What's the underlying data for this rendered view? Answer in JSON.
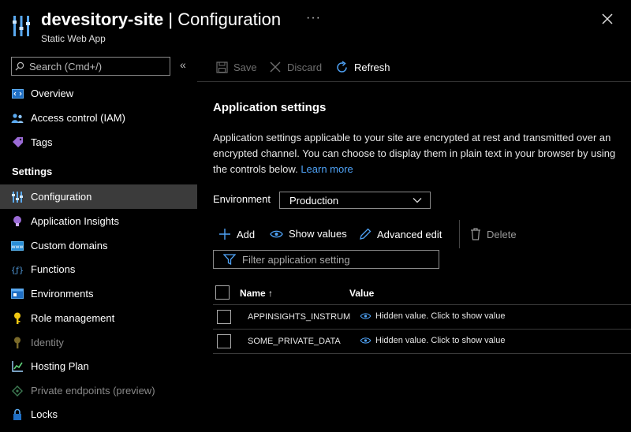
{
  "header": {
    "resource_name": "devesitory-site",
    "separator": " | ",
    "blade_title": "Configuration",
    "subtitle": "Static Web App",
    "more_label": "···"
  },
  "sidebar": {
    "search_placeholder": "Search (Cmd+/)",
    "collapse_label": "«",
    "top_items": [
      {
        "label": "Overview",
        "icon": "overview-icon"
      },
      {
        "label": "Access control (IAM)",
        "icon": "people-icon"
      },
      {
        "label": "Tags",
        "icon": "tag-icon"
      }
    ],
    "section_label": "Settings",
    "settings_items": [
      {
        "label": "Configuration",
        "icon": "sliders-icon",
        "active": true
      },
      {
        "label": "Application Insights",
        "icon": "lightbulb-icon"
      },
      {
        "label": "Custom domains",
        "icon": "globe-box-icon"
      },
      {
        "label": "Functions",
        "icon": "function-icon"
      },
      {
        "label": "Environments",
        "icon": "environment-icon"
      },
      {
        "label": "Role management",
        "icon": "key-icon"
      },
      {
        "label": "Identity",
        "icon": "identity-key-icon",
        "disabled": true
      },
      {
        "label": "Hosting Plan",
        "icon": "chart-icon"
      },
      {
        "label": "Private endpoints (preview)",
        "icon": "endpoints-icon",
        "disabled": true
      },
      {
        "label": "Locks",
        "icon": "lock-icon"
      }
    ]
  },
  "toolbar": {
    "save_label": "Save",
    "discard_label": "Discard",
    "refresh_label": "Refresh"
  },
  "main": {
    "heading": "Application settings",
    "description": "Application settings applicable to your site are encrypted at rest and transmitted over an encrypted channel. You can choose to display them in plain text in your browser by using the controls below.",
    "learn_more": "Learn more",
    "environment_label": "Environment",
    "environment_value": "Production",
    "actions": {
      "add": "Add",
      "show_values": "Show values",
      "advanced_edit": "Advanced edit",
      "delete": "Delete"
    },
    "filter_placeholder": "Filter application setting",
    "table": {
      "headers": {
        "name": "Name ↑",
        "value": "Value"
      },
      "rows": [
        {
          "name": "APPINSIGHTS_INSTRUM",
          "value": "Hidden value. Click to show value"
        },
        {
          "name": "SOME_PRIVATE_DATA",
          "value": "Hidden value. Click to show value"
        }
      ]
    }
  },
  "colors": {
    "accent": "#4fa3f7",
    "background": "#000000",
    "active_nav": "#3b3b3b"
  }
}
